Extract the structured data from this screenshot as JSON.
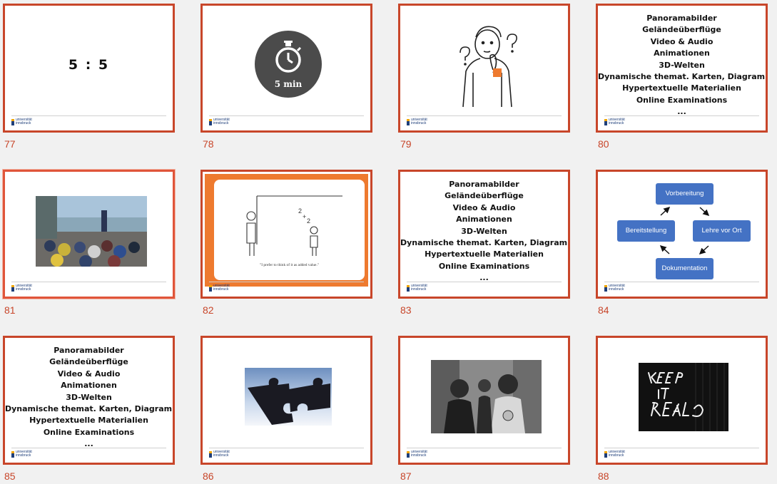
{
  "slides": [
    {
      "number": "77",
      "type": "score",
      "text": "5 : 5"
    },
    {
      "number": "78",
      "type": "timer",
      "timer_label": "5 min",
      "icon": "stopwatch-icon"
    },
    {
      "number": "79",
      "type": "thinking",
      "icon": "thinking-person-icon"
    },
    {
      "number": "80",
      "type": "list"
    },
    {
      "number": "81",
      "type": "photo",
      "image": "group-of-students-photo"
    },
    {
      "number": "82",
      "type": "cartoon",
      "caption": "\"I prefer to think of it as added value.\""
    },
    {
      "number": "83",
      "type": "list"
    },
    {
      "number": "84",
      "type": "cycle"
    },
    {
      "number": "85",
      "type": "list"
    },
    {
      "number": "86",
      "type": "photo",
      "image": "puzzle-pieces-photo"
    },
    {
      "number": "87",
      "type": "photo",
      "image": "hip-hop-group-photo"
    },
    {
      "number": "88",
      "type": "photo",
      "image": "keep-it-real-graffiti-photo"
    }
  ],
  "list_items": [
    "Panoramabilder",
    "Geländeüberflüge",
    "Video & Audio",
    "Animationen",
    "3D-Welten",
    "Dynamische themat. Karten, Diagramme etc.",
    "Hypertextuelle Materialien",
    "Online Examinations",
    "..."
  ],
  "cycle": {
    "top": "Vorbereitung",
    "right": "Lehre vor Ort",
    "bottom": "Dokumentation",
    "left": "Bereitstellung"
  },
  "footer": {
    "logo": "universität\ninnsbruck"
  },
  "colors": {
    "slide_border": "#c8462a",
    "number": "#c8462a",
    "cycle_box": "#4472c4",
    "cartoon_bg": "#ee7a2f",
    "timer_circle": "#4b4b4b"
  }
}
